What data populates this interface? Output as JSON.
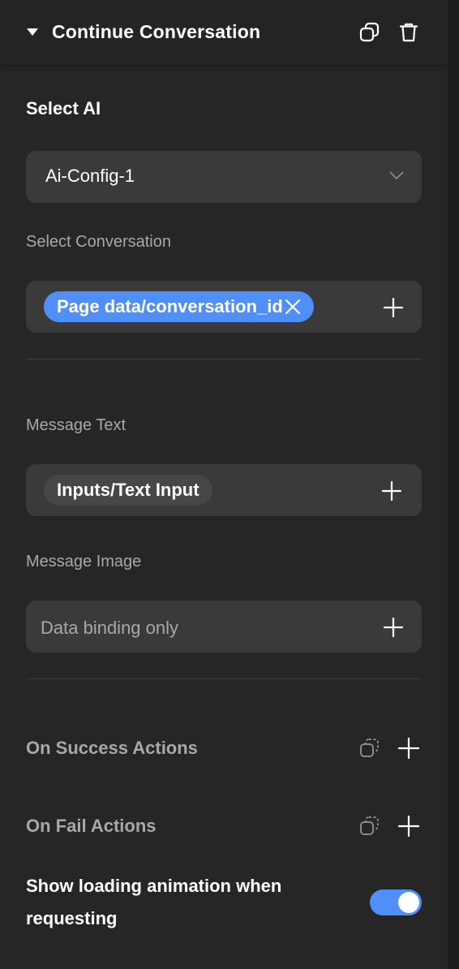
{
  "header": {
    "title": "Continue Conversation",
    "icons": [
      "caret-down-icon",
      "duplicate-icon",
      "trash-icon"
    ]
  },
  "select_ai": {
    "label": "Select AI",
    "value": "Ai-Config-1"
  },
  "select_conversation": {
    "label": "Select Conversation",
    "chip": "Page data/conversation_id"
  },
  "message_text": {
    "label": "Message Text",
    "chip": "Inputs/Text Input"
  },
  "message_image": {
    "label": "Message Image",
    "placeholder": "Data binding only"
  },
  "actions": {
    "success_label": "On Success Actions",
    "fail_label": "On Fail Actions"
  },
  "loading": {
    "label": "Show loading animation when requesting",
    "enabled": true
  },
  "colors": {
    "panel": "#262626",
    "field": "#3a3a3a",
    "accent": "#4f8ff7",
    "muted_text": "#a8a8a8"
  }
}
